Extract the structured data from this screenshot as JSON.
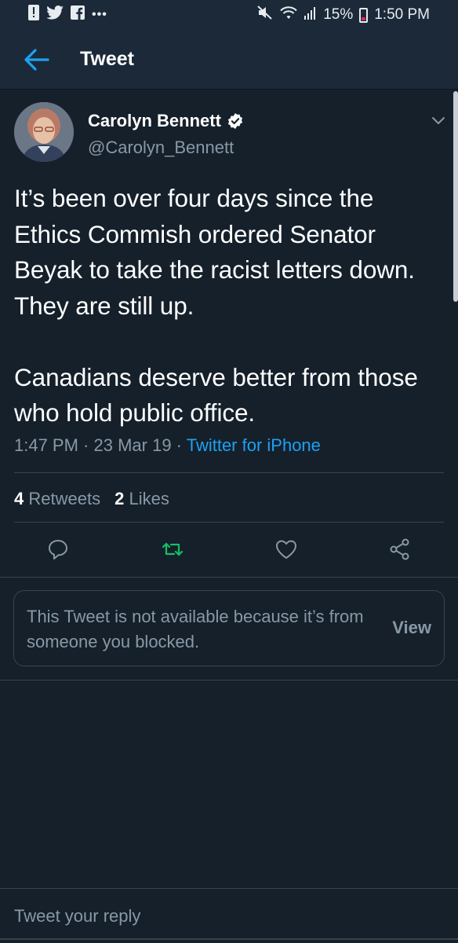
{
  "status_bar": {
    "battery": "15%",
    "time": "1:50 PM",
    "icons": [
      "notification-alert-icon",
      "twitter-bird-icon",
      "facebook-icon",
      "more-dots-icon",
      "mute-icon",
      "wifi-icon",
      "signal-icon",
      "battery-icon"
    ]
  },
  "header": {
    "title": "Tweet",
    "back_icon": "arrow-left-icon"
  },
  "tweet": {
    "author_name": "Carolyn Bennett",
    "author_handle": "@Carolyn_Bennett",
    "text": "It’s been over four days since the Ethics Commish ordered Senator Beyak to take the racist letters down. They are still up.\n\nCanadians deserve better from those who hold public office.",
    "time": "1:47 PM",
    "date": "23 Mar 19",
    "source": "Twitter for iPhone",
    "separator": " · ",
    "retweet_count": "4",
    "retweet_label": "Retweets",
    "like_count": "2",
    "like_label": "Likes"
  },
  "blocked_card": {
    "message": "This Tweet is not available because it’s from someone you blocked.",
    "view_label": "View"
  },
  "reply": {
    "placeholder": "Tweet your reply"
  },
  "colors": {
    "background": "#15202b",
    "bar": "#1c2938",
    "accent": "#1da1f2",
    "muted": "#8899a6",
    "retweet_green": "#17bf63",
    "divider": "#38444d"
  }
}
